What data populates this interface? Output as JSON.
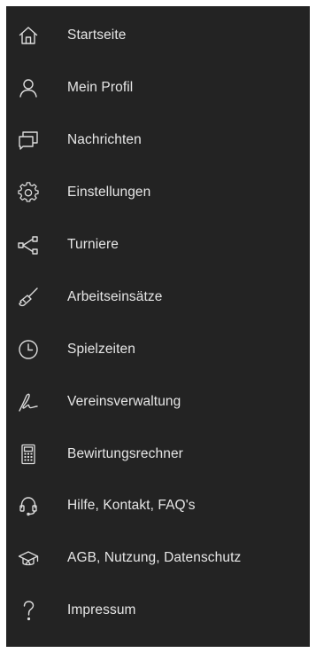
{
  "drawer": {
    "background": "#232323",
    "text_color": "#e6e6e6",
    "icon_color": "#dcdcdc",
    "items": [
      {
        "label": "Startseite",
        "icon": "home-icon"
      },
      {
        "label": "Mein Profil",
        "icon": "user-icon"
      },
      {
        "label": "Nachrichten",
        "icon": "messages-icon"
      },
      {
        "label": "Einstellungen",
        "icon": "gear-icon"
      },
      {
        "label": "Turniere",
        "icon": "bracket-icon"
      },
      {
        "label": "Arbeitseinsätze",
        "icon": "broom-icon"
      },
      {
        "label": "Spielzeiten",
        "icon": "clock-icon"
      },
      {
        "label": "Vereinsverwaltung",
        "icon": "signature-icon"
      },
      {
        "label": "Bewirtungsrechner",
        "icon": "calculator-icon"
      },
      {
        "label": "Hilfe, Kontakt, FAQ's",
        "icon": "headset-icon"
      },
      {
        "label": "AGB, Nutzung, Datenschutz",
        "icon": "graduation-cap-icon"
      },
      {
        "label": "Impressum",
        "icon": "question-mark-icon"
      }
    ]
  }
}
